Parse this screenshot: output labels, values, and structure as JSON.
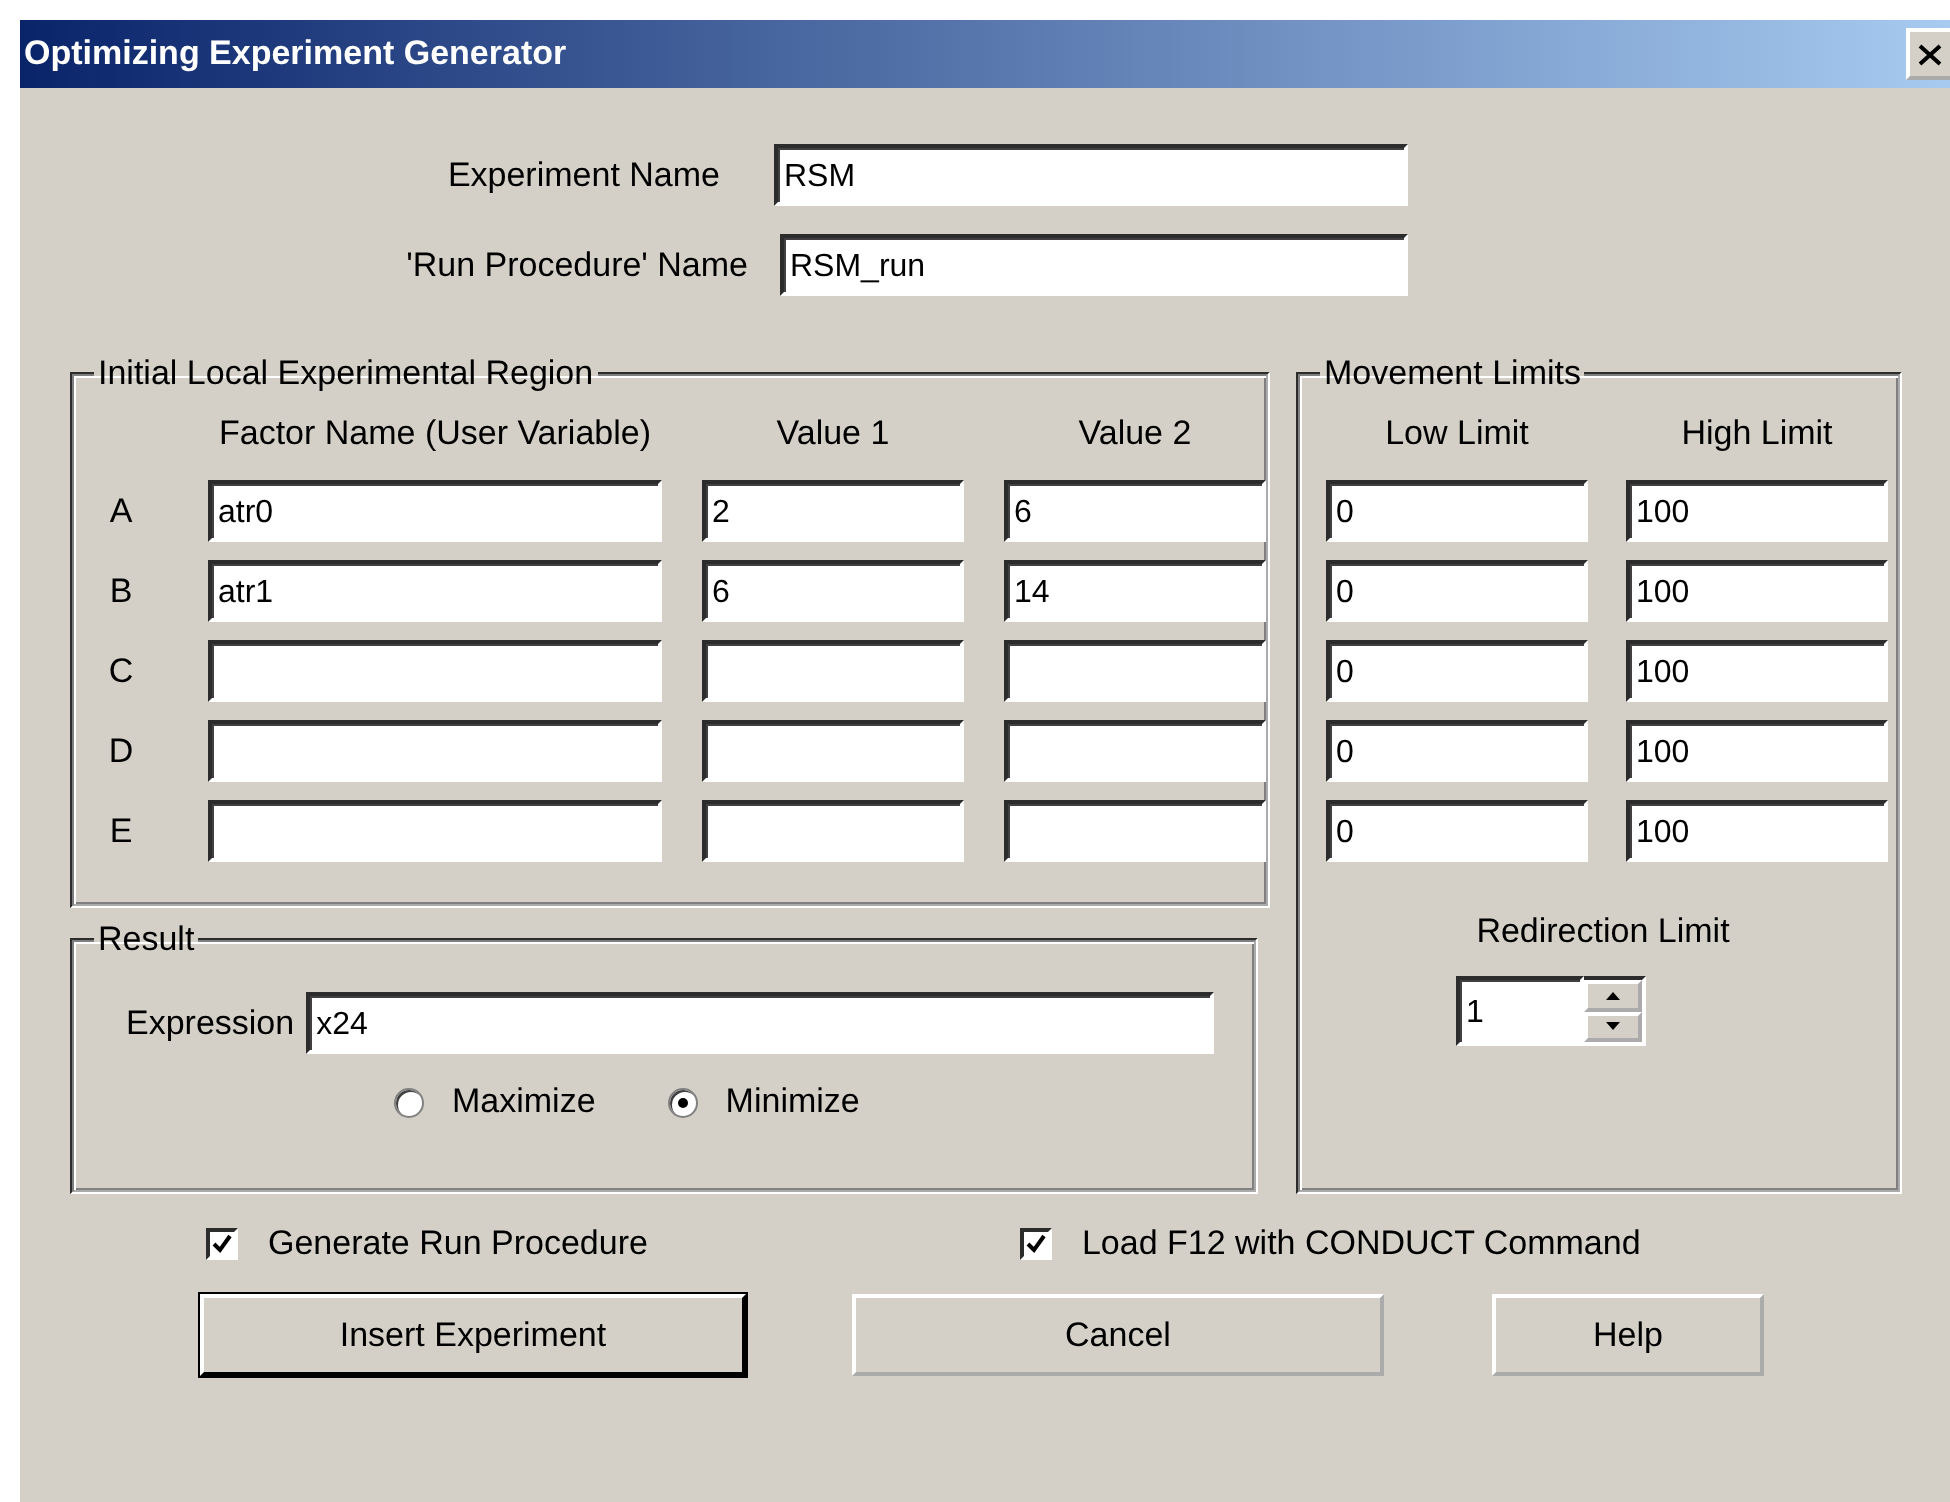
{
  "window": {
    "title": "Optimizing Experiment Generator"
  },
  "names": [
    {
      "label": "Experiment Name",
      "value": "RSM"
    },
    {
      "label": "'Run Procedure' Name",
      "value": "RSM_run"
    }
  ],
  "initial_region": {
    "title": "Initial Local Experimental Region",
    "columns": [
      "Factor Name (User Variable)",
      "Value 1",
      "Value 2"
    ],
    "rows": [
      {
        "letter": "A",
        "factor": "atr0",
        "value_1": "2",
        "value_2": "6"
      },
      {
        "letter": "B",
        "factor": "atr1",
        "value_1": "6",
        "value_2": "14"
      },
      {
        "letter": "C"
      },
      {
        "letter": "D"
      },
      {
        "letter": "E"
      }
    ]
  },
  "result": {
    "title": "Result",
    "expression": {
      "label": "Expression",
      "value": "x24"
    },
    "options": [
      {
        "label": "Maximize",
        "selected": false
      },
      {
        "label": "Minimize",
        "selected": true
      }
    ]
  },
  "movement_limits": {
    "title": "Movement Limits",
    "columns": [
      "Low Limit",
      "High Limit"
    ],
    "rows": [
      {
        "low": "0",
        "high": "100"
      },
      {
        "low": "0",
        "high": "100"
      },
      {
        "low": "0",
        "high": "100"
      },
      {
        "low": "0",
        "high": "100"
      },
      {
        "low": "0",
        "high": "100"
      }
    ],
    "redirection_limit": {
      "label": "Redirection Limit",
      "value": "1"
    }
  },
  "checkboxes": [
    {
      "label": "Generate Run Procedure",
      "checked": true
    },
    {
      "label": "Load F12 with CONDUCT Command",
      "checked": true
    }
  ],
  "buttons": [
    {
      "label": "Insert Experiment",
      "default": true
    },
    {
      "label": "Cancel",
      "default": false
    },
    {
      "label": "Help",
      "default": false
    }
  ]
}
